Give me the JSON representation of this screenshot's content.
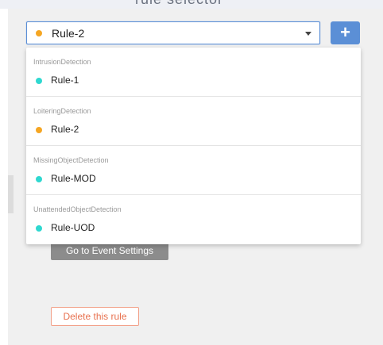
{
  "header": {
    "title_fragment": "rule selector"
  },
  "selector": {
    "selected_label": "Rule-2",
    "selected_color": "#f5a623",
    "add_label": "+"
  },
  "dropdown": {
    "groups": [
      {
        "header": "IntrusionDetection",
        "option": "Rule-1",
        "color": "#2fd8d0"
      },
      {
        "header": "LoiteringDetection",
        "option": "Rule-2",
        "color": "#f5a623"
      },
      {
        "header": "MissingObjectDetection",
        "option": "Rule-MOD",
        "color": "#2fd8d0"
      },
      {
        "header": "UnattendedObjectDetection",
        "option": "Rule-UOD",
        "color": "#2fd8d0"
      }
    ]
  },
  "actions": {
    "event_settings_label": "Go to Event Settings",
    "delete_label": "Delete this rule"
  },
  "colors": {
    "accent": "#5b8fd6",
    "danger": "#e8714f"
  }
}
